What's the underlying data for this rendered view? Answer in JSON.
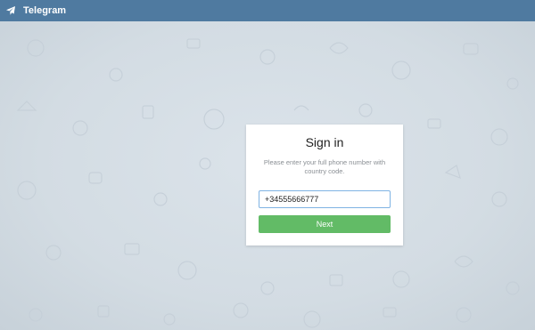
{
  "app": {
    "title": "Telegram",
    "logo_icon": "paper-plane-icon"
  },
  "signin": {
    "title": "Sign in",
    "description": "Please enter your full phone number with country code.",
    "phone_value": "+34555666777",
    "next_label": "Next"
  },
  "colors": {
    "header": "#4f7aa0",
    "background": "#dfe6ec",
    "accent": "#62bb66",
    "input_border": "#7fb3e3"
  }
}
